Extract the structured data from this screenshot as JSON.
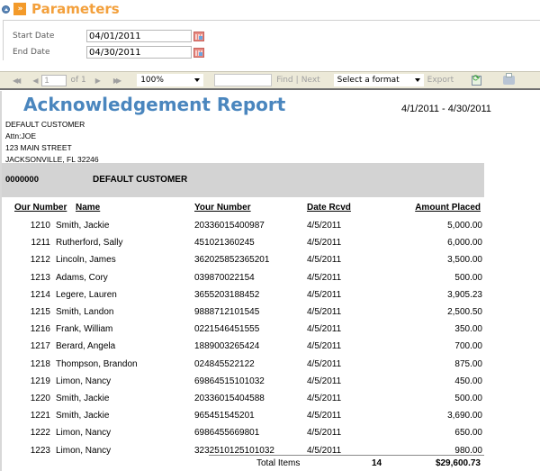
{
  "parameters": {
    "title": "Parameters",
    "fields": [
      {
        "label": "Start Date",
        "value": "04/01/2011"
      },
      {
        "label": "End Date",
        "value": "04/30/2011"
      }
    ]
  },
  "toolbar": {
    "first_page": "◀◀",
    "prev_page": "◀",
    "page_value": "1",
    "of_label": "of 1",
    "next_page": "▶",
    "last_page": "▶▶",
    "zoom": "100%",
    "find_value": "",
    "find_label": "Find",
    "separator": "|",
    "next_label": "Next",
    "format_select": "Select a format",
    "export_label": "Export"
  },
  "report": {
    "title": "Acknowledgement Report",
    "date_range": "4/1/2011 - 4/30/2011",
    "address": [
      "DEFAULT CUSTOMER",
      "Attn:JOE",
      "123 MAIN STREET",
      "JACKSONVILLE, FL 32246"
    ],
    "group": {
      "id": "0000000",
      "name": "DEFAULT CUSTOMER"
    },
    "columns": {
      "our_number": "Our Number",
      "name": "Name",
      "your_number": "Your Number",
      "date_rcvd": "Date Rcvd",
      "amount": "Amount Placed"
    },
    "rows": [
      {
        "our": "1210",
        "name": "Smith, Jackie",
        "your": "20336015400987",
        "date": "4/5/2011",
        "amount": "5,000.00"
      },
      {
        "our": "1211",
        "name": "Rutherford, Sally",
        "your": "451021360245",
        "date": "4/5/2011",
        "amount": "6,000.00"
      },
      {
        "our": "1212",
        "name": "Lincoln, James",
        "your": "362025852365201",
        "date": "4/5/2011",
        "amount": "3,500.00"
      },
      {
        "our": "1213",
        "name": "Adams, Cory",
        "your": "039870022154",
        "date": "4/5/2011",
        "amount": "500.00"
      },
      {
        "our": "1214",
        "name": "Legere, Lauren",
        "your": "3655203188452",
        "date": "4/5/2011",
        "amount": "3,905.23"
      },
      {
        "our": "1215",
        "name": "Smith, Landon",
        "your": "9888712101545",
        "date": "4/5/2011",
        "amount": "2,500.50"
      },
      {
        "our": "1216",
        "name": "Frank, William",
        "your": "0221546451555",
        "date": "4/5/2011",
        "amount": "350.00"
      },
      {
        "our": "1217",
        "name": "Berard, Angela",
        "your": "1889003265424",
        "date": "4/5/2011",
        "amount": "700.00"
      },
      {
        "our": "1218",
        "name": "Thompson, Brandon",
        "your": "024845522122",
        "date": "4/5/2011",
        "amount": "875.00"
      },
      {
        "our": "1219",
        "name": "Limon, Nancy",
        "your": "69864515101032",
        "date": "4/5/2011",
        "amount": "450.00"
      },
      {
        "our": "1220",
        "name": "Smith, Jackie",
        "your": "20336015404588",
        "date": "4/5/2011",
        "amount": "500.00"
      },
      {
        "our": "1221",
        "name": "Smith, Jackie",
        "your": "965451545201",
        "date": "4/5/2011",
        "amount": "3,690.00"
      },
      {
        "our": "1222",
        "name": "Limon, Nancy",
        "your": "6986455669801",
        "date": "4/5/2011",
        "amount": "650.00"
      },
      {
        "our": "1223",
        "name": "Limon, Nancy",
        "your": "3232510125101032",
        "date": "4/5/2011",
        "amount": "980.00"
      }
    ],
    "totals": {
      "label": "Total Items",
      "count": "14",
      "amount": "$29,600.73"
    }
  }
}
